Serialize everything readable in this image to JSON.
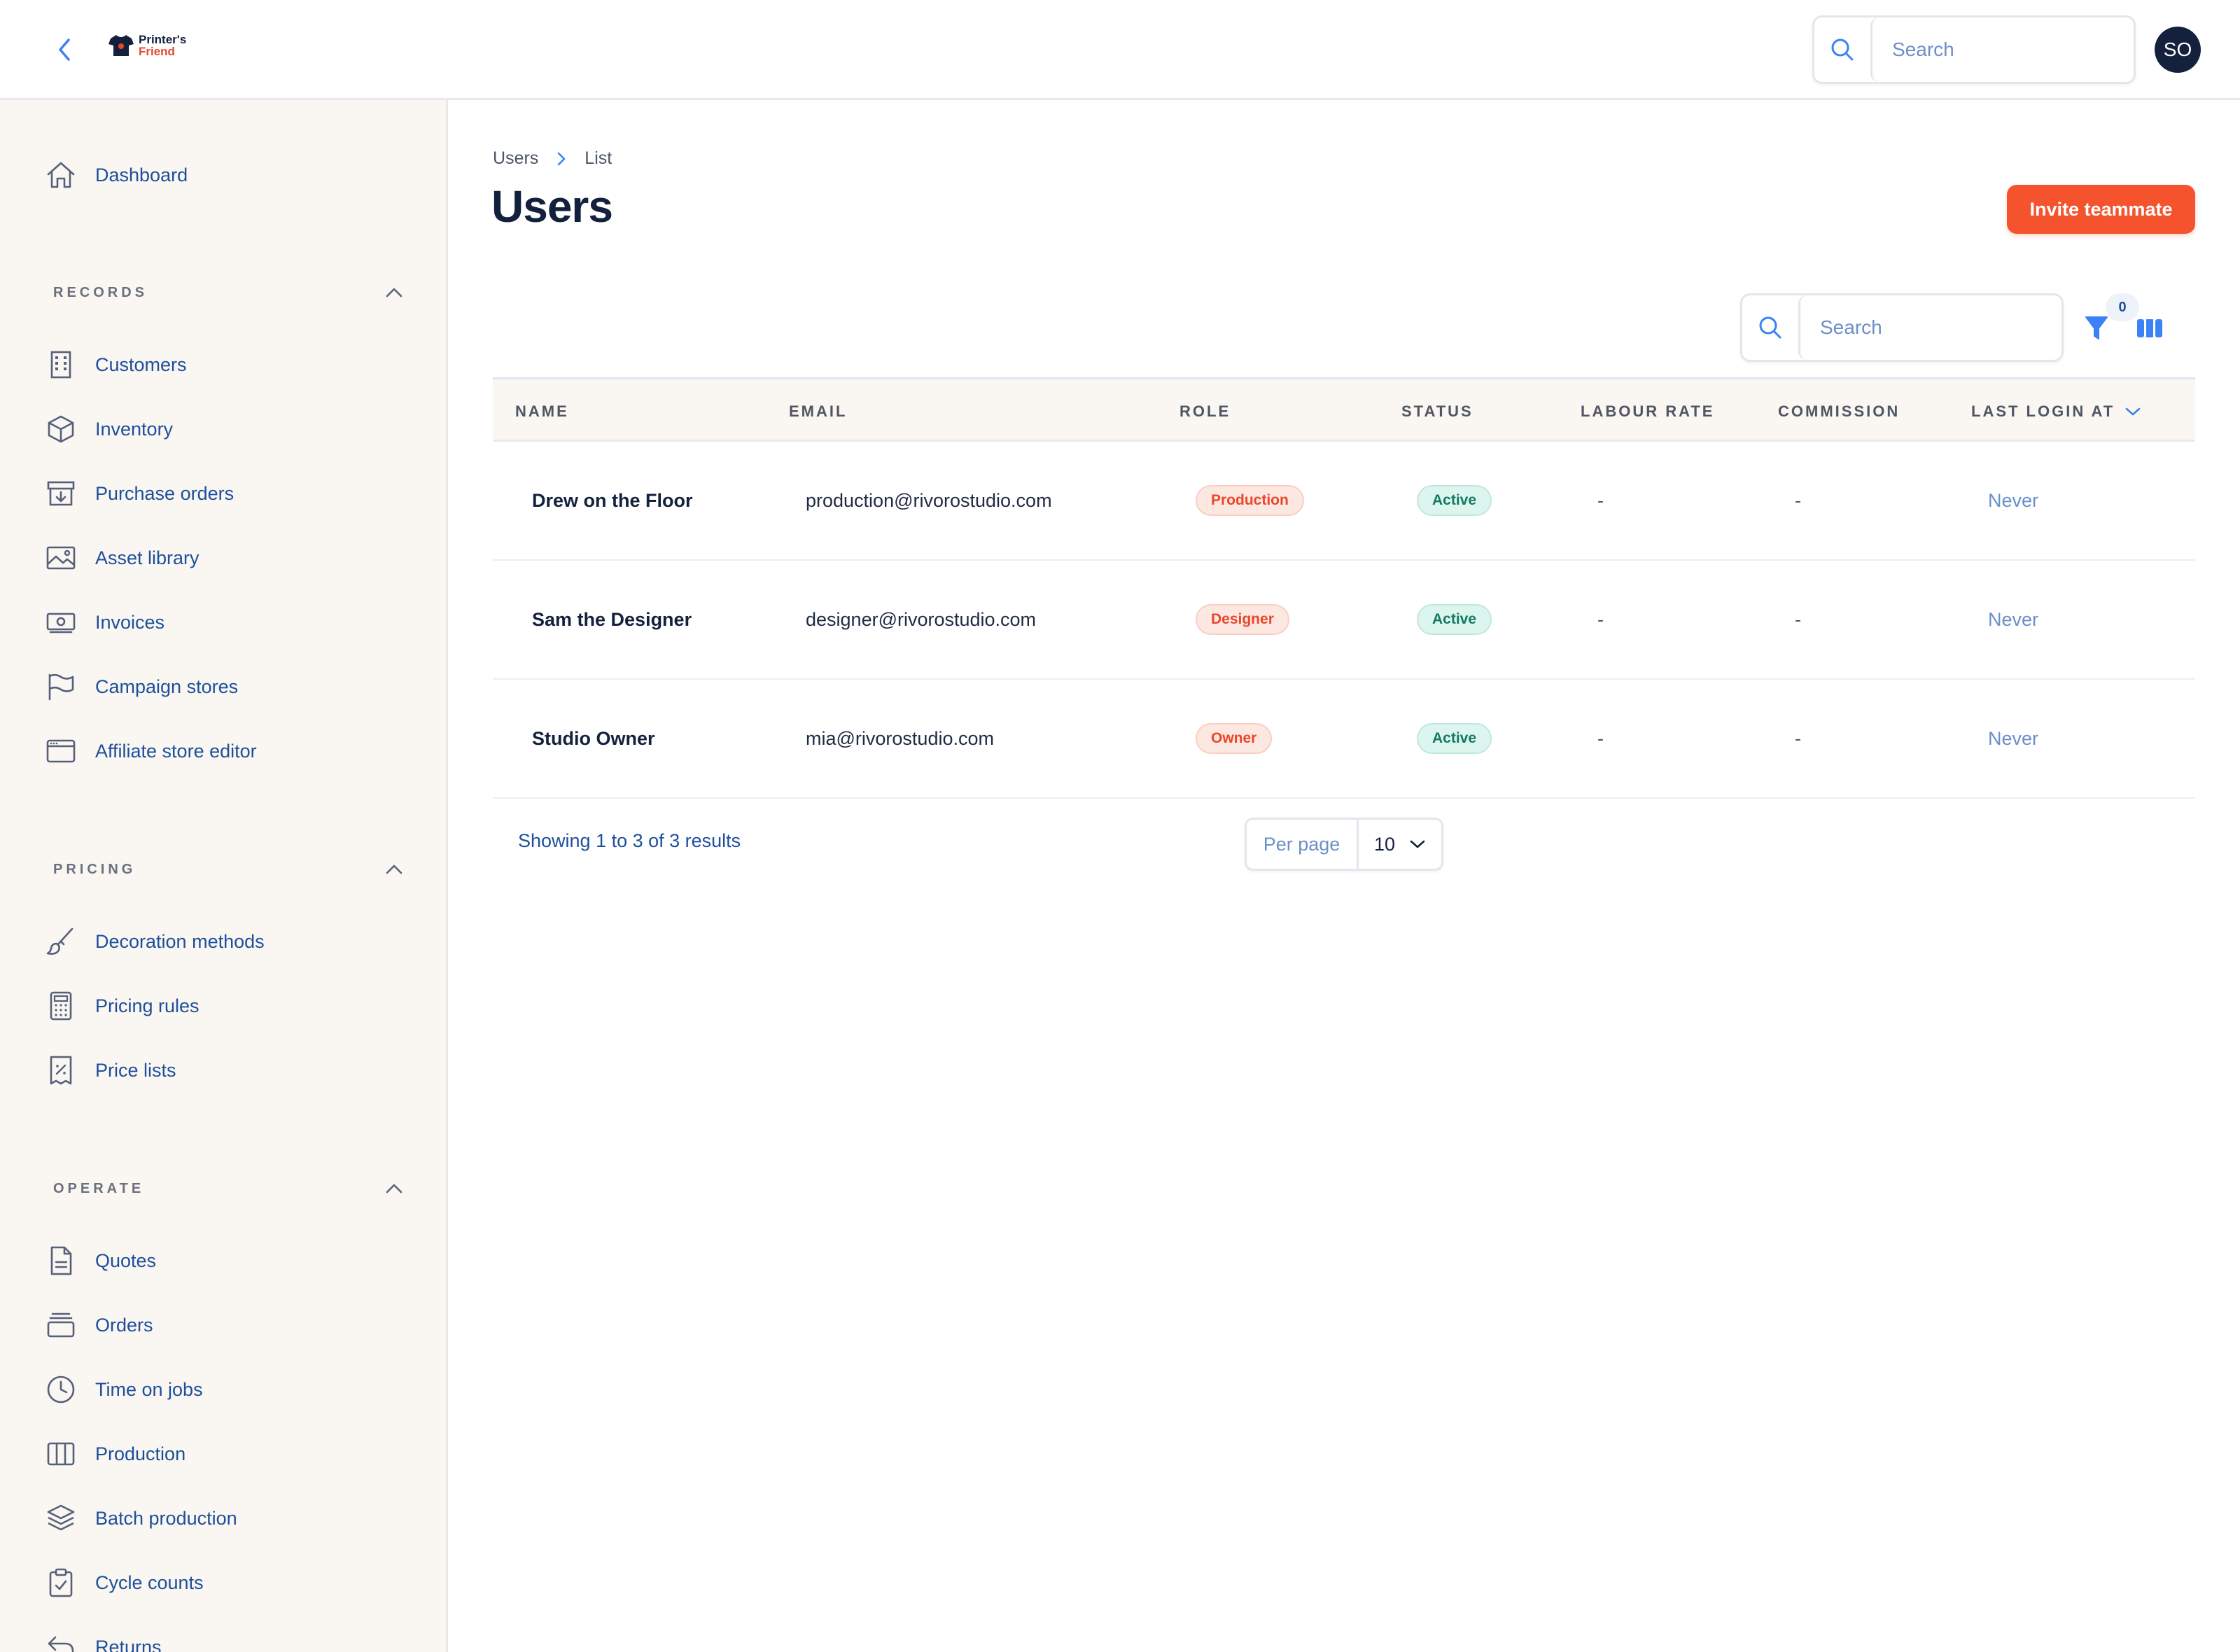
{
  "app": {
    "logo_line1": "Printer's",
    "logo_line2": "Friend"
  },
  "header": {
    "search_placeholder": "Search",
    "avatar_initials": "SO"
  },
  "sidebar": {
    "dashboard_label": "Dashboard",
    "sections": [
      {
        "title": "RECORDS",
        "items": [
          {
            "label": "Customers",
            "icon": "building-icon"
          },
          {
            "label": "Inventory",
            "icon": "box-icon"
          },
          {
            "label": "Purchase orders",
            "icon": "archive-download-icon"
          },
          {
            "label": "Asset library",
            "icon": "image-icon"
          },
          {
            "label": "Invoices",
            "icon": "cash-icon"
          },
          {
            "label": "Campaign stores",
            "icon": "flag-icon"
          },
          {
            "label": "Affiliate store editor",
            "icon": "browser-window-icon"
          }
        ]
      },
      {
        "title": "PRICING",
        "items": [
          {
            "label": "Decoration methods",
            "icon": "brush-icon"
          },
          {
            "label": "Pricing rules",
            "icon": "calculator-icon"
          },
          {
            "label": "Price lists",
            "icon": "receipt-percent-icon"
          }
        ]
      },
      {
        "title": "OPERATE",
        "items": [
          {
            "label": "Quotes",
            "icon": "document-icon"
          },
          {
            "label": "Orders",
            "icon": "inbox-stack-icon"
          },
          {
            "label": "Time on jobs",
            "icon": "clock-icon"
          },
          {
            "label": "Production",
            "icon": "columns-icon"
          },
          {
            "label": "Batch production",
            "icon": "layers-icon"
          },
          {
            "label": "Cycle counts",
            "icon": "clipboard-check-icon"
          },
          {
            "label": "Returns",
            "icon": "return-arrow-icon"
          }
        ]
      }
    ]
  },
  "main": {
    "breadcrumb": [
      "Users",
      "List"
    ],
    "title": "Users",
    "invite_label": "Invite teammate",
    "table_search_placeholder": "Search",
    "filter_count": "0",
    "columns": [
      "NAME",
      "EMAIL",
      "ROLE",
      "STATUS",
      "LABOUR RATE",
      "COMMISSION",
      "LAST LOGIN AT"
    ],
    "rows": [
      {
        "name": "Drew on the Floor",
        "email": "production@rivorostudio.com",
        "role": "Production",
        "status": "Active",
        "labour_rate": "-",
        "commission": "-",
        "last_login": "Never"
      },
      {
        "name": "Sam the Designer",
        "email": "designer@rivorostudio.com",
        "role": "Designer",
        "status": "Active",
        "labour_rate": "-",
        "commission": "-",
        "last_login": "Never"
      },
      {
        "name": "Studio Owner",
        "email": "mia@rivorostudio.com",
        "role": "Owner",
        "status": "Active",
        "labour_rate": "-",
        "commission": "-",
        "last_login": "Never"
      }
    ],
    "pagination": {
      "summary": "Showing 1 to 3 of 3 results",
      "per_page_label": "Per page",
      "per_page_value": "10"
    }
  },
  "colors": {
    "accent": "#f4532e",
    "link": "#1d4f9c",
    "navy": "#14213d",
    "sidebar_bg": "#faf6f1"
  }
}
